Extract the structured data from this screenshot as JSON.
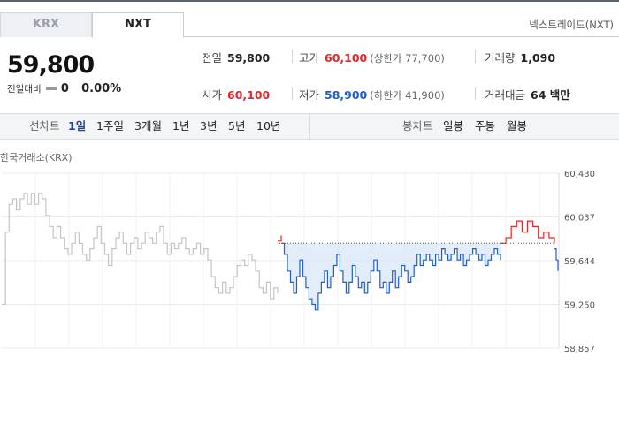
{
  "tabs": [
    {
      "label": "KRX",
      "active": false
    },
    {
      "label": "NXT",
      "active": true
    }
  ],
  "venue_label": "넥스트레이드(NXT)",
  "quote": {
    "price": "59,800",
    "change_label": "전일대비",
    "change_value": "0",
    "change_pct": "0.00%"
  },
  "stats": {
    "prev_close": {
      "label": "전일",
      "value": "59,800"
    },
    "high": {
      "label": "고가",
      "value": "60,100",
      "sub": "(상한가 77,700)"
    },
    "volume": {
      "label": "거래량",
      "value": "1,090"
    },
    "open": {
      "label": "시가",
      "value": "60,100"
    },
    "low": {
      "label": "저가",
      "value": "58,900",
      "sub": "(하한가 41,900)"
    },
    "turnover": {
      "label": "거래대금",
      "value": "64 백만"
    }
  },
  "period_bar": {
    "line_header": "선차트",
    "line_periods": [
      "1일",
      "1주일",
      "3개월",
      "1년",
      "3년",
      "5년",
      "10년"
    ],
    "active_period": "1일",
    "candle_header": "봉차트",
    "candle_periods": [
      "일봉",
      "주봉",
      "월봉"
    ]
  },
  "chart_title": "한국거래소(KRX)",
  "colors": {
    "up": "#e0282d",
    "down": "#1f5fcc",
    "flat_krx": "#c4c4c4",
    "accent_tab": "#1d3fa7"
  },
  "chart_data": {
    "type": "line",
    "title": "",
    "y_ticks": [
      "60,430",
      "60,037",
      "59,644",
      "59,250",
      "58,857"
    ],
    "ylim": [
      58857,
      60430
    ],
    "reference_price": 59800,
    "grid": true,
    "series": [
      {
        "segment": "krx-gray",
        "values": [
          59250,
          59900,
          60150,
          60200,
          60100,
          60200,
          60250,
          60150,
          60250,
          60150,
          60250,
          60200,
          60050,
          59950,
          59850,
          59950,
          59850,
          59750,
          59700,
          59800,
          59900,
          59800,
          59700,
          59650,
          59750,
          59850,
          59950,
          59800,
          59700,
          59600,
          59750,
          59850,
          59900,
          59800,
          59700,
          59800,
          59850,
          59750,
          59800,
          59900,
          59850,
          59800,
          59900,
          59950,
          59800,
          59700,
          59800,
          59750,
          59800,
          59850,
          59750,
          59700,
          59750,
          59800,
          59700,
          59750,
          59650,
          59500,
          59400,
          59350,
          59450,
          59350,
          59400,
          59500,
          59600,
          59650,
          59600,
          59700,
          59650,
          59550,
          59400,
          59350,
          59450,
          59300,
          59400,
          59350
        ]
      },
      {
        "segment": "nxt-up",
        "values": [
          59820,
          59870
        ]
      },
      {
        "segment": "nxt-down",
        "values": [
          59800,
          59700,
          59550,
          59450,
          59350,
          59500,
          59650,
          59500,
          59400,
          59300,
          59250,
          59200,
          59350,
          59450,
          59550,
          59400,
          59500,
          59600,
          59700,
          59550,
          59450,
          59350,
          59450,
          59600,
          59500,
          59400,
          59450,
          59350,
          59450,
          59550,
          59650,
          59550,
          59400,
          59450,
          59350,
          59450,
          59550,
          59400,
          59500,
          59600,
          59550,
          59450,
          59500,
          59600,
          59700,
          59600,
          59650,
          59700,
          59650,
          59600,
          59700,
          59650,
          59750,
          59700,
          59650,
          59700,
          59750,
          59650,
          59700,
          59600,
          59650,
          59700,
          59750,
          59700,
          59650,
          59700,
          59600,
          59650,
          59700,
          59750,
          59700,
          59650
        ]
      },
      {
        "segment": "nxt-up-late",
        "values": [
          59800,
          59850,
          59950,
          60000,
          59900,
          60000,
          59950,
          59850,
          59900,
          59850,
          59800
        ]
      },
      {
        "segment": "nxt-close",
        "values": [
          59750,
          59650,
          59550
        ]
      }
    ]
  }
}
